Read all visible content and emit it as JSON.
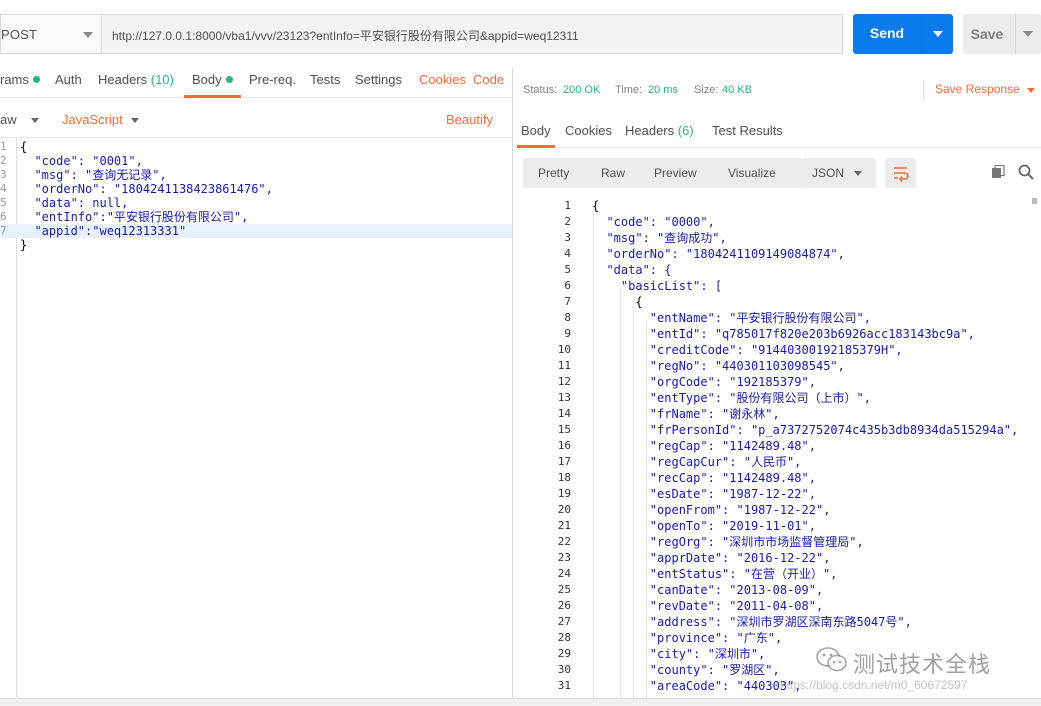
{
  "request": {
    "method": "POST",
    "url": "http://127.0.0.1:8000/vba1/vvv/23123?entInfo=平安银行股份有限公司&appid=weq12311",
    "send_label": "Send",
    "save_label": "Save"
  },
  "request_tabs": [
    {
      "label": "rams",
      "dot": true
    },
    {
      "label": "Auth"
    },
    {
      "label": "Headers ",
      "count": "(10)"
    },
    {
      "label": "Body",
      "dot": true,
      "active": true
    },
    {
      "label": "Pre-req."
    },
    {
      "label": "Tests"
    },
    {
      "label": "Settings"
    },
    {
      "label": "Cookies"
    },
    {
      "label": "Code"
    }
  ],
  "body_options": {
    "mode": "aw",
    "language": "JavaScript",
    "beautify": "Beautify"
  },
  "request_body": [
    {
      "n": "1",
      "t": "{"
    },
    {
      "n": "2",
      "t": "  \"code\": \"0001\","
    },
    {
      "n": "3",
      "t": "  \"msg\": \"查询无记录\","
    },
    {
      "n": "4",
      "t": "  \"orderNo\": \"1804241138423861476\","
    },
    {
      "n": "5",
      "t": "  \"data\": null,"
    },
    {
      "n": "6",
      "t": "  \"entInfo\":\"平安银行股份有限公司\","
    },
    {
      "n": "7",
      "t": "  \"appid\":\"weq12313331\""
    },
    {
      "n": "",
      "t": "}"
    }
  ],
  "response": {
    "status_label": "Status:",
    "status_value": "200 OK",
    "time_label": "Time:",
    "time_value": "20 ms",
    "size_label": "Size:",
    "size_value": "40 KB",
    "save_response": "Save Response",
    "tabs": [
      {
        "label": "Body",
        "active": true
      },
      {
        "label": "Cookies"
      },
      {
        "label": "Headers ",
        "count": "(6)"
      },
      {
        "label": "Test Results"
      }
    ],
    "views": [
      "Pretty",
      "Raw",
      "Preview",
      "Visualize"
    ],
    "format": "JSON"
  },
  "response_body": [
    {
      "n": "1",
      "t": "{"
    },
    {
      "n": "2",
      "t": "  \"code\": \"0000\","
    },
    {
      "n": "3",
      "t": "  \"msg\": \"查询成功\","
    },
    {
      "n": "4",
      "t": "  \"orderNo\": \"1804241109149084874\","
    },
    {
      "n": "5",
      "t": "  \"data\": {"
    },
    {
      "n": "6",
      "t": "    \"basicList\": ["
    },
    {
      "n": "7",
      "t": "      {"
    },
    {
      "n": "8",
      "t": "        \"entName\": \"平安银行股份有限公司\","
    },
    {
      "n": "9",
      "t": "        \"entId\": \"q785017f820e203b6926acc183143bc9a\","
    },
    {
      "n": "10",
      "t": "        \"creditCode\": \"91440300192185379H\","
    },
    {
      "n": "11",
      "t": "        \"regNo\": \"440301103098545\","
    },
    {
      "n": "12",
      "t": "        \"orgCode\": \"192185379\","
    },
    {
      "n": "13",
      "t": "        \"entType\": \"股份有限公司（上市）\","
    },
    {
      "n": "14",
      "t": "        \"frName\": \"谢永林\","
    },
    {
      "n": "15",
      "t": "        \"frPersonId\": \"p_a7372752074c435b3db8934da515294a\","
    },
    {
      "n": "16",
      "t": "        \"regCap\": \"1142489.48\","
    },
    {
      "n": "17",
      "t": "        \"regCapCur\": \"人民币\","
    },
    {
      "n": "18",
      "t": "        \"recCap\": \"1142489.48\","
    },
    {
      "n": "19",
      "t": "        \"esDate\": \"1987-12-22\","
    },
    {
      "n": "20",
      "t": "        \"openFrom\": \"1987-12-22\","
    },
    {
      "n": "21",
      "t": "        \"openTo\": \"2019-11-01\","
    },
    {
      "n": "22",
      "t": "        \"regOrg\": \"深圳市市场监督管理局\","
    },
    {
      "n": "23",
      "t": "        \"apprDate\": \"2016-12-22\","
    },
    {
      "n": "24",
      "t": "        \"entStatus\": \"在营（开业）\","
    },
    {
      "n": "25",
      "t": "        \"canDate\": \"2013-08-09\","
    },
    {
      "n": "26",
      "t": "        \"revDate\": \"2011-04-08\","
    },
    {
      "n": "27",
      "t": "        \"address\": \"深圳市罗湖区深南东路5047号\","
    },
    {
      "n": "28",
      "t": "        \"province\": \"广东\","
    },
    {
      "n": "29",
      "t": "        \"city\": \"深圳市\","
    },
    {
      "n": "30",
      "t": "        \"county\": \"罗湖区\","
    },
    {
      "n": "31",
      "t": "        \"areaCode\": \"440303\","
    }
  ],
  "watermark": {
    "text": "测试技术全栈",
    "url": "https://blog.csdn.net/m0_60672597"
  }
}
